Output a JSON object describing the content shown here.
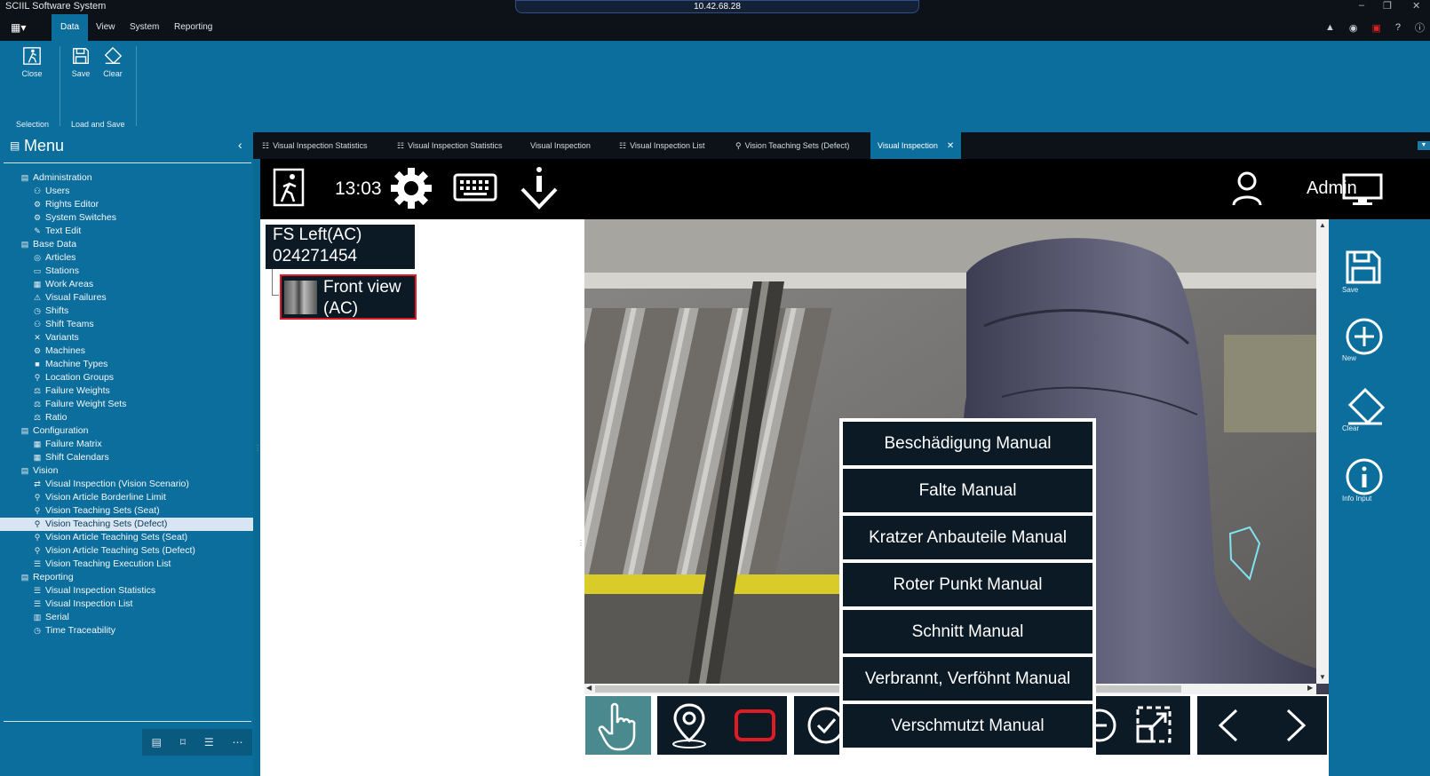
{
  "titlebar": {
    "app_title": "SCIIL Software System",
    "remote_text": "10.42.68.28",
    "min": "–",
    "max": "❐",
    "close": "✕"
  },
  "menubar": {
    "tabs": [
      "Data",
      "View",
      "System",
      "Reporting"
    ],
    "active": "Data"
  },
  "ribbon": {
    "buttons": {
      "close": "Close",
      "save": "Save",
      "clear": "Clear"
    },
    "groups": {
      "selection": "Selection",
      "load_save": "Load and Save"
    }
  },
  "menu": {
    "title": "Menu",
    "tree": [
      {
        "type": "cat",
        "label": "Administration",
        "icon": "grid-icon"
      },
      {
        "type": "child",
        "label": "Users",
        "icon": "users-icon"
      },
      {
        "type": "child",
        "label": "Rights Editor",
        "icon": "rights-icon"
      },
      {
        "type": "child",
        "label": "System Switches",
        "icon": "switches-icon"
      },
      {
        "type": "child",
        "label": "Text Edit",
        "icon": "edit-icon"
      },
      {
        "type": "cat",
        "label": "Base Data",
        "icon": "grid-icon"
      },
      {
        "type": "child",
        "label": "Articles",
        "icon": "articles-icon"
      },
      {
        "type": "child",
        "label": "Stations",
        "icon": "stations-icon"
      },
      {
        "type": "child",
        "label": "Work Areas",
        "icon": "work-areas-icon"
      },
      {
        "type": "child",
        "label": "Visual Failures",
        "icon": "warning-icon"
      },
      {
        "type": "child",
        "label": "Shifts",
        "icon": "clock-icon"
      },
      {
        "type": "child",
        "label": "Shift Teams",
        "icon": "teams-icon"
      },
      {
        "type": "child",
        "label": "Variants",
        "icon": "variants-icon"
      },
      {
        "type": "child",
        "label": "Machines",
        "icon": "machines-icon"
      },
      {
        "type": "child",
        "label": "Machine Types",
        "icon": "machine-types-icon"
      },
      {
        "type": "child",
        "label": "Location Groups",
        "icon": "location-icon"
      },
      {
        "type": "child",
        "label": "Failure Weights",
        "icon": "weights-icon"
      },
      {
        "type": "child",
        "label": "Failure Weight Sets",
        "icon": "weights-icon"
      },
      {
        "type": "child",
        "label": "Ratio",
        "icon": "weights-icon"
      },
      {
        "type": "cat",
        "label": "Configuration",
        "icon": "grid-icon"
      },
      {
        "type": "child",
        "label": "Failure Matrix",
        "icon": "matrix-icon"
      },
      {
        "type": "child",
        "label": "Shift Calendars",
        "icon": "calendar-icon"
      },
      {
        "type": "cat",
        "label": "Vision",
        "icon": "grid-icon"
      },
      {
        "type": "child",
        "label": "Visual Inspection (Vision Scenario)",
        "icon": "inspection-icon"
      },
      {
        "type": "child",
        "label": "Vision Article Borderline Limit",
        "icon": "location-icon"
      },
      {
        "type": "child",
        "label": "Vision Teaching Sets (Seat)",
        "icon": "location-icon"
      },
      {
        "type": "child",
        "label": "Vision Teaching Sets (Defect)",
        "icon": "location-icon",
        "selected": true
      },
      {
        "type": "child",
        "label": "Vision Article Teaching Sets (Seat)",
        "icon": "location-icon"
      },
      {
        "type": "child",
        "label": "Vision Article Teaching Sets (Defect)",
        "icon": "location-icon"
      },
      {
        "type": "child",
        "label": "Vision Teaching Execution List",
        "icon": "list-icon"
      },
      {
        "type": "cat",
        "label": "Reporting",
        "icon": "grid-icon"
      },
      {
        "type": "child",
        "label": "Visual Inspection Statistics",
        "icon": "list-icon"
      },
      {
        "type": "child",
        "label": "Visual Inspection List",
        "icon": "list-icon"
      },
      {
        "type": "child",
        "label": "Serial",
        "icon": "barcode-icon"
      },
      {
        "type": "child",
        "label": "Time Traceability",
        "icon": "time-trace-icon"
      }
    ]
  },
  "doc_tabs": [
    {
      "label": "Visual Inspection Statistics",
      "icon": "list-icon"
    },
    {
      "label": "Visual Inspection Statistics",
      "icon": "list-icon"
    },
    {
      "label": "Visual Inspection",
      "icon": ""
    },
    {
      "label": "Visual Inspection List",
      "icon": "list-icon"
    },
    {
      "label": "Vision Teaching Sets (Defect)",
      "icon": "location-icon"
    },
    {
      "label": "Visual Inspection",
      "icon": "",
      "active": true
    }
  ],
  "toolbar": {
    "time": "13:03",
    "user": "Admin"
  },
  "inspection_tree": {
    "parent_line1": "FS Left(AC)",
    "parent_line2": "024271454",
    "child_line1": "Front view",
    "child_line2": "(AC)"
  },
  "context_menu": {
    "items": [
      "Beschädigung Manual",
      "Falte Manual",
      "Kratzer Anbauteile Manual",
      "Roter Punkt Manual",
      "Schnitt Manual",
      "Verbrannt, Verföhnt Manual",
      "Verschmutzt Manual"
    ]
  },
  "side_panel": {
    "save": "Save",
    "new": "New",
    "clear": "Clear",
    "info": "Info Input"
  },
  "colors": {
    "brand_blue": "#0b6e9c",
    "dark_navy": "#0c1a26",
    "selection_red": "#e01b24",
    "outline_cyan": "#7fe3f0"
  }
}
